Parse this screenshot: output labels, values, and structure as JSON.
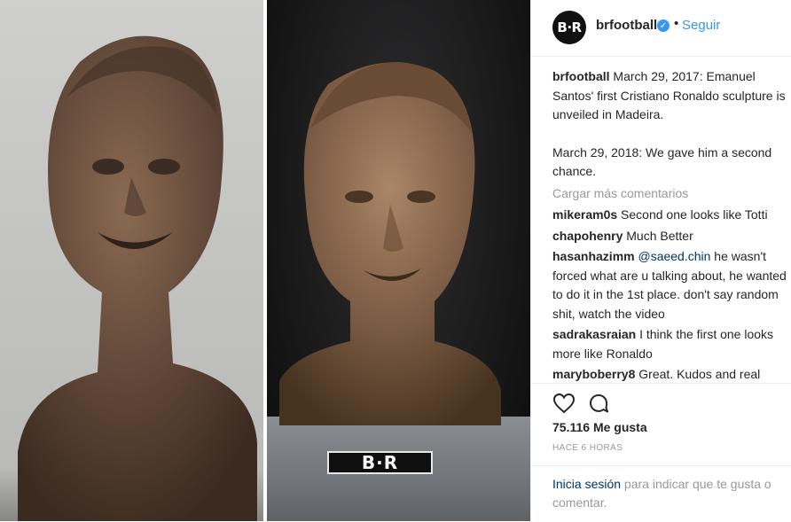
{
  "media": {
    "plate_text": "B·R"
  },
  "header": {
    "avatar_text": "B·R",
    "username": "brfootball",
    "separator": "•",
    "follow_label": "Seguir"
  },
  "caption": {
    "username": "brfootball",
    "text_line1": " March 29, 2017: Emanuel Santos' first Cristiano Ronaldo sculpture is unveiled in Madeira.",
    "text_line2": "March 29, 2018: We gave him a second chance."
  },
  "load_more": "Cargar más comentarios",
  "comments": [
    {
      "user": "mikeram0s",
      "text": " Second one looks like Totti"
    },
    {
      "user": "chapohenry",
      "text": " Much Better"
    },
    {
      "user": "hasanhazimm",
      "mention": " @saeed.chin",
      "text": " he wasn't forced what are u talking about, he wanted to do it in the 1st place. don't say random shit, watch the video"
    },
    {
      "user": "sadrakasraian",
      "text": " I think the first one looks more like Ronaldo"
    },
    {
      "user": "maryboberry8",
      "text": " Great. Kudos and real respect to the sculptor. This family went through a lot during the Nollie lol"
    }
  ],
  "likes": "75.116 Me gusta",
  "time_ago": "HACE 6 HORAS",
  "login": {
    "link": "Inicia sesión",
    "rest": " para indicar que te gusta o comentar."
  }
}
